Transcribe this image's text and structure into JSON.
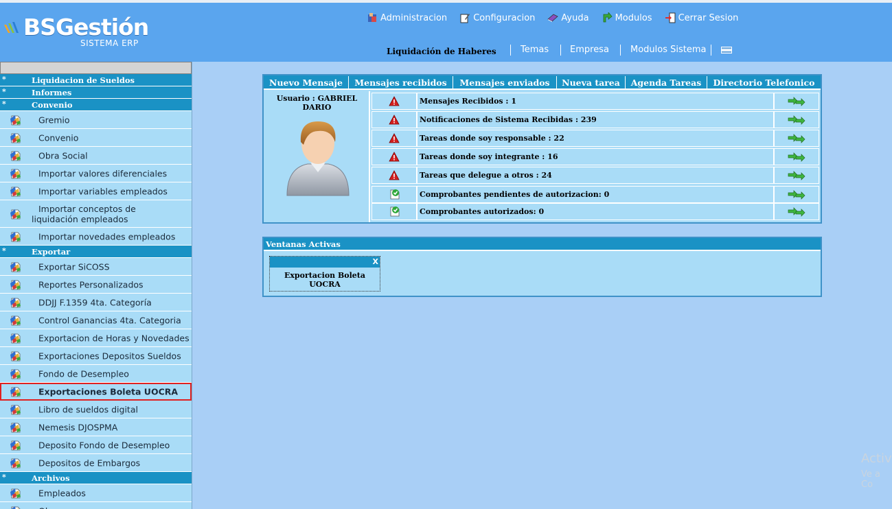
{
  "brand": {
    "name": "BSGestión",
    "tagline": "SISTEMA ERP"
  },
  "topmenu": [
    {
      "label": "Administracion",
      "icon": "users-icon"
    },
    {
      "label": "Configuracion",
      "icon": "edit-icon"
    },
    {
      "label": "Ayuda",
      "icon": "book-icon"
    },
    {
      "label": "Modulos",
      "icon": "arrow-icon"
    },
    {
      "label": "Cerrar Sesion",
      "icon": "logout-icon"
    }
  ],
  "subbar": {
    "module_title": "Liquidación de Haberes",
    "links": [
      "Temas",
      "Empresa",
      "Modulos Sistema"
    ]
  },
  "sidebar": {
    "cat_liquidacion": "Liquidacion de Sueldos",
    "cat_informes": "Informes",
    "cat_convenio": "Convenio",
    "convenio_items": [
      "Gremio",
      "Convenio",
      "Obra Social",
      "Importar valores diferenciales",
      "Importar variables empleados",
      "Importar conceptos de liquidación empleados",
      "Importar novedades empleados"
    ],
    "cat_exportar": "Exportar",
    "exportar_items": [
      "Exportar SiCOSS",
      "Reportes Personalizados",
      "DDJJ F.1359 4ta. Categoría",
      "Control Ganancias 4ta. Categoria",
      "Exportacion de Horas y Novedades",
      "Exportaciones Depositos Sueldos",
      "Fondo de Desempleo",
      "Exportaciones Boleta UOCRA",
      "Libro de sueldos digital",
      "Nemesis DJOSPMA",
      "Deposito Fondo de Desempleo",
      "Depositos de Embargos"
    ],
    "cat_archivos": "Archivos",
    "archivos_items": [
      "Empleados",
      "Obra"
    ]
  },
  "tabs": [
    "Nuevo Mensaje",
    "Mensajes recibidos",
    "Mensajes enviados",
    "Nueva tarea",
    "Agenda Tareas",
    "Directorio Telefonico"
  ],
  "user": {
    "label": "Usuario : GABRIEL DARIO"
  },
  "notifications": [
    {
      "text": "Mensajes Recibidos : 1",
      "status": "warning"
    },
    {
      "text": "Notificaciones de Sistema Recibidas : 239",
      "status": "warning"
    },
    {
      "text": "Tareas donde soy responsable : 22",
      "status": "warning"
    },
    {
      "text": "Tareas donde soy integrante : 16",
      "status": "warning"
    },
    {
      "text": "Tareas que delegue a otros : 24",
      "status": "warning"
    },
    {
      "text": "Comprobantes pendientes de autorizacion: 0",
      "status": "ok"
    },
    {
      "text": "Comprobantes autorizados: 0",
      "status": "ok"
    }
  ],
  "ventanas": {
    "title": "Ventanas Activas",
    "close_label": "X",
    "window_title": "Exportacion Boleta UOCRA"
  },
  "watermark": {
    "line1": "Activ",
    "line2": "Ve a Co"
  },
  "colors": {
    "header": "#5aa5ee",
    "accent": "#1a92c5",
    "item_bg": "#a9dcf7",
    "selected_border": "#e02020"
  }
}
